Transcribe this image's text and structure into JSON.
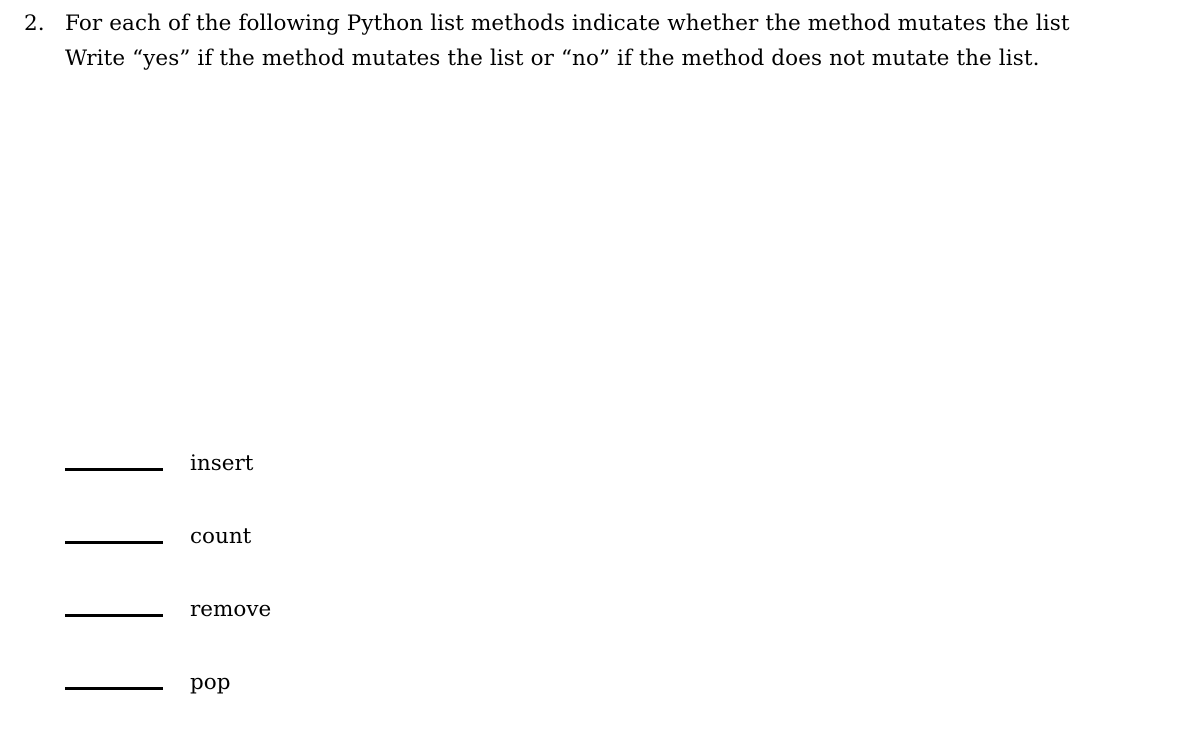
{
  "document": {
    "background_color": "#ffffff",
    "text_color": "#000000"
  },
  "question": {
    "number": "2.",
    "lines": [
      "For each of the following Python list methods indicate whether the method mutates the list",
      "Write “yes” if the method mutates the list or “no” if the method does not mutate the list."
    ],
    "line_1": "For each of the following Python list methods indicate whether the method mutates the list",
    "line_2": "Write “yes” if the method mutates the list or “no” if the method does not mutate the list."
  },
  "answers": {
    "blank_placeholder": "",
    "items": [
      {
        "blank": "",
        "method": "insert"
      },
      {
        "blank": "",
        "method": "count"
      },
      {
        "blank": "",
        "method": "remove"
      },
      {
        "blank": "",
        "method": "pop"
      }
    ]
  }
}
